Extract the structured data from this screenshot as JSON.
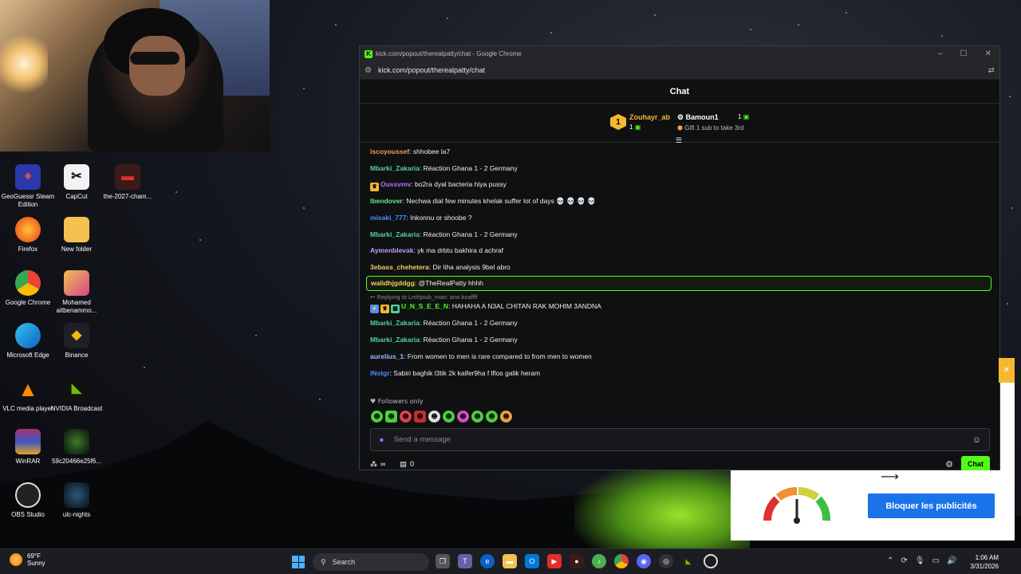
{
  "desktop": {
    "icons": [
      {
        "label": "GeoGuessr Steam Edition",
        "icon": "geoguessr-icon"
      },
      {
        "label": "CapCut",
        "icon": "capcut-icon"
      },
      {
        "label": "the-2027-cham...",
        "icon": "file-icon"
      },
      {
        "label": "Firefox",
        "icon": "firefox-icon"
      },
      {
        "label": "New folder",
        "icon": "folder-icon"
      },
      {
        "label": "Google Chrome",
        "icon": "chrome-icon"
      },
      {
        "label": "Mohamed aitbenammo...",
        "icon": "folder-icon"
      },
      {
        "label": "Microsoft Edge",
        "icon": "edge-icon"
      },
      {
        "label": "Binance",
        "icon": "binance-icon"
      },
      {
        "label": "VLC media player",
        "icon": "vlc-icon"
      },
      {
        "label": "NVIDIA Broadcast",
        "icon": "nvidia-icon"
      },
      {
        "label": "WinRAR",
        "icon": "winrar-icon"
      },
      {
        "label": "59c20466e25f6...",
        "icon": "image-icon"
      },
      {
        "label": "OBS Studio",
        "icon": "obs-icon"
      },
      {
        "label": "ulc-nights",
        "icon": "image-icon"
      }
    ]
  },
  "window": {
    "title": "kick.com/popout/therealpatty/chat - Google Chrome",
    "url": "kick.com/popout/therealpatty/chat",
    "controls": [
      "–",
      "☐",
      "✕"
    ]
  },
  "chat": {
    "header_title": "Chat",
    "leaderboard": {
      "first_rank": "1",
      "first_name": "Zouhayr_ab",
      "first_count": "1",
      "second_name": "Bamoun1",
      "second_count": "1",
      "second_sub": "Gift 1 sub to take 3rd"
    },
    "messages": [
      {
        "user": "iscoyoussef",
        "text": ": shhobee la7",
        "color": "#f5a04a"
      },
      {
        "user": "Mbarki_Zakaria",
        "text": ": Réaction Ghana 1 - 2 Germany",
        "color": "#4ed1a0"
      },
      {
        "user": "Oussvmv",
        "text": ": bo2ra dyal bacteria hiya pussy",
        "color": "#b86cff"
      },
      {
        "user": "lbendover",
        "text": ": Nechwa dial few minutes khelak suffer lot of days 💀 💀 💀 💀",
        "color": "#68e88a"
      },
      {
        "user": "misaki_777",
        "text": ": Inkonnu or shoobe ?",
        "color": "#4a8dff"
      },
      {
        "user": "Mbarki_Zakaria",
        "text": ": Réaction Ghana 1 - 2 Germany",
        "color": "#4ed1a0"
      },
      {
        "user": "Aymenblevak",
        "text": ": yk ma drbtu bakhira d achraf",
        "color": "#c79bff"
      },
      {
        "user": "3ebass_chehetera",
        "text": ": Dir liha analysis 9bel abro",
        "color": "#f0d060"
      },
      {
        "user": "walidhjgddgg",
        "text": ": @TheRealPatty hhhh",
        "color": "#f0d060"
      },
      {
        "user": "U_N_S_E_E_N",
        "text": ": HAHAHA A N3AL CHITAN RAK MOHIM 3ANDNA",
        "color": "#53fc18"
      },
      {
        "user": "Mbarki_Zakaria",
        "text": ": Réaction Ghana 1 - 2 Germany",
        "color": "#4ed1a0"
      },
      {
        "user": "Mbarki_Zakaria",
        "text": ": Réaction Ghana 1 - 2 Germany",
        "color": "#4ed1a0"
      },
      {
        "user": "aurelius_1",
        "text": ": From women to men is rare compared to from men to women",
        "color": "#9bbcff"
      },
      {
        "user": "lNstgr",
        "text": ": Sabiri baghik l3tik 2k kaifer9ha f lflos galik heram",
        "color": "#4a8dff"
      }
    ],
    "reply_context": "Replying to Lmhjoub_man: ana bzaffff",
    "followers_only": "Followers only",
    "input_placeholder": "Send a message",
    "footer": {
      "viewers_value": "∞",
      "gift_count": "0",
      "send_label": "Chat"
    }
  },
  "ad": {
    "button_label": "Bloquer les publicités",
    "close": "✕"
  },
  "taskbar": {
    "temperature": "69°F",
    "condition": "Sunny",
    "search_label": "Search",
    "time": "1:06 AM",
    "date": "3/31/2026"
  },
  "colors": {
    "kick_green": "#53fc18",
    "gold": "#f5b82e",
    "ad_blue": "#1a73e8"
  }
}
